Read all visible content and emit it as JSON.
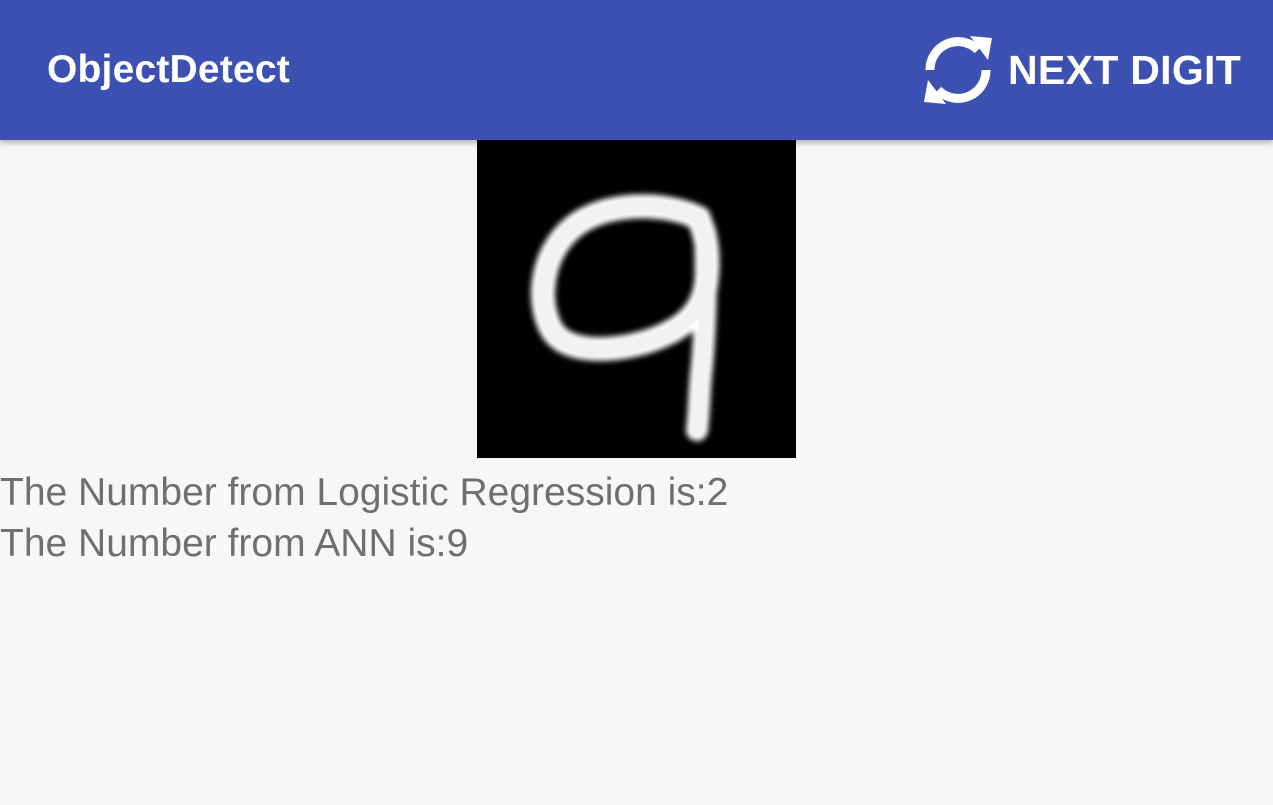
{
  "app_bar": {
    "title": "ObjectDetect",
    "background_color": "#3d51b2",
    "action": {
      "label": "NEXT DIGIT",
      "icon": "refresh-icon"
    }
  },
  "digit_image": {
    "depicted_digit": "9",
    "background_color": "#000000",
    "stroke_color": "#ffffff"
  },
  "results": {
    "logistic_regression": "The Number from Logistic Regression is:2",
    "ann": "The Number from ANN is:9"
  }
}
